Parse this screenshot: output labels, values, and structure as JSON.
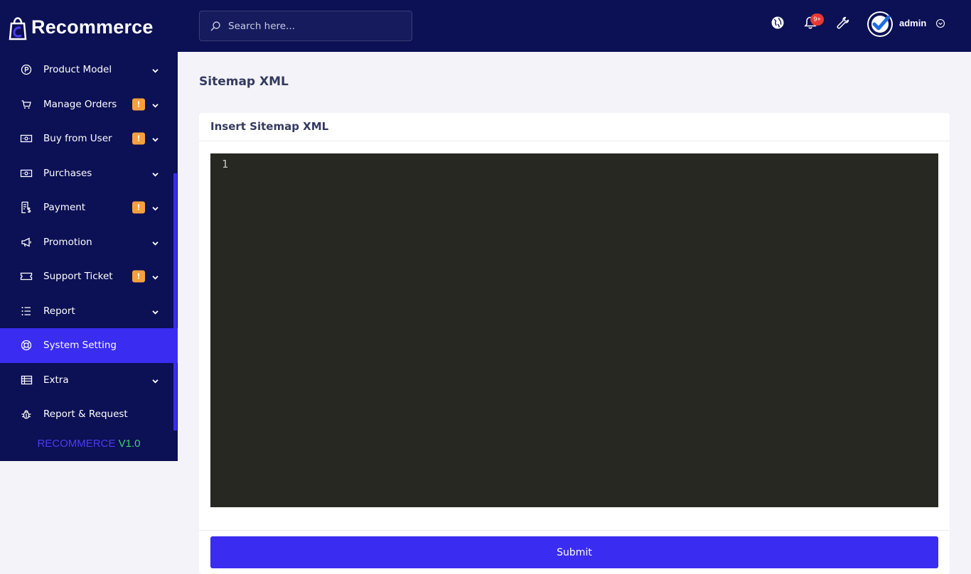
{
  "brand": {
    "logo_text": "Recommerce"
  },
  "search": {
    "placeholder": "Search here..."
  },
  "topbar": {
    "notification_count": "9+",
    "user_name": "admin"
  },
  "sidebar": {
    "items": [
      {
        "label": "Product Model",
        "icon": "product-circle-icon",
        "badge": "",
        "has_chevron": true
      },
      {
        "label": "Manage Orders",
        "icon": "cart-icon",
        "badge": "!",
        "has_chevron": true
      },
      {
        "label": "Buy from User",
        "icon": "cash-icon",
        "badge": "!",
        "has_chevron": true
      },
      {
        "label": "Purchases",
        "icon": "cash-icon",
        "badge": "",
        "has_chevron": true
      },
      {
        "label": "Payment",
        "icon": "invoice-dollar-icon",
        "badge": "!",
        "has_chevron": true
      },
      {
        "label": "Promotion",
        "icon": "megaphone-icon",
        "badge": "",
        "has_chevron": true
      },
      {
        "label": "Support Ticket",
        "icon": "ticket-icon",
        "badge": "!",
        "has_chevron": true
      },
      {
        "label": "Report",
        "icon": "list-icon",
        "badge": "",
        "has_chevron": true
      },
      {
        "label": "System Setting",
        "icon": "lifebuoy-icon",
        "badge": "",
        "has_chevron": false,
        "active": true
      },
      {
        "label": "Extra",
        "icon": "table-icon",
        "badge": "",
        "has_chevron": true
      },
      {
        "label": "Report & Request",
        "icon": "bug-icon",
        "badge": "",
        "has_chevron": false
      }
    ],
    "version_brand": "RECOMMERCE",
    "version_number": "V1.0"
  },
  "main": {
    "page_title": "Sitemap XML",
    "card_title": "Insert Sitemap XML",
    "editor": {
      "line_number": "1",
      "value": ""
    },
    "submit_label": "Submit"
  },
  "colors": {
    "navy": "#0c1054",
    "accent": "#3a2cf0",
    "badge": "#f7a03d",
    "editor_bg": "#272822",
    "version_green": "#3bd46f"
  }
}
